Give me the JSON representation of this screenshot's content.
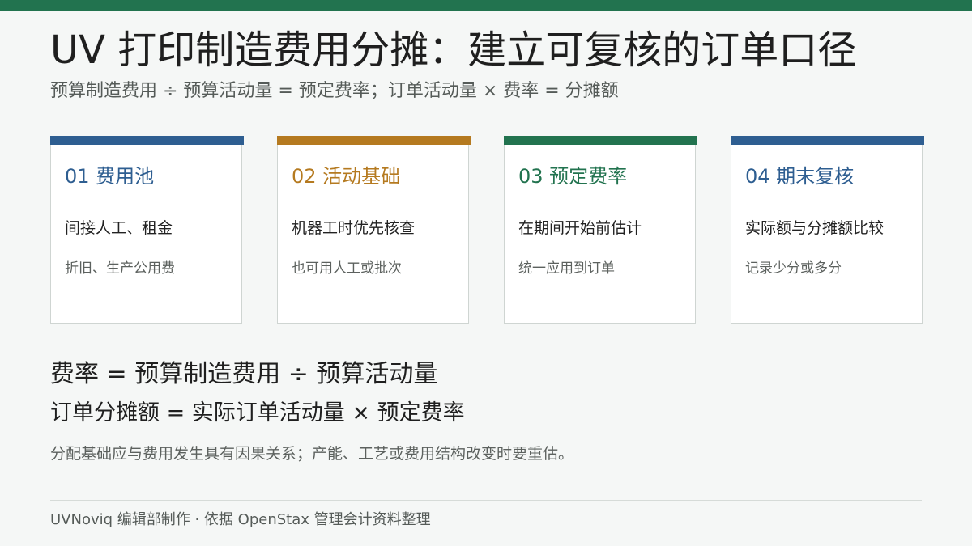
{
  "title": "UV 打印制造费用分摊：建立可复核的订单口径",
  "subtitle": "预算制造费用 ÷ 预算活动量 = 预定费率；订单活动量 × 费率 = 分摊额",
  "cards": [
    {
      "title": "01 费用池",
      "line1": "间接人工、租金",
      "line2": "折旧、生产公用费",
      "color": "#2e5e91"
    },
    {
      "title": "02 活动基础",
      "line1": "机器工时优先核查",
      "line2": "也可用人工或批次",
      "color": "#b57a20"
    },
    {
      "title": "03 预定费率",
      "line1": "在期间开始前估计",
      "line2": "统一应用到订单",
      "color": "#22734f"
    },
    {
      "title": "04 期末复核",
      "line1": "实际额与分摊额比较",
      "line2": "记录少分或多分",
      "color": "#2e5e91"
    }
  ],
  "formula1": "费率 = 预算制造费用 ÷ 预算活动量",
  "formula2": "订单分摊额 = 实际订单活动量 × 预定费率",
  "note": "分配基础应与费用发生具有因果关系；产能、工艺或费用结构改变时要重估。",
  "footer": "UVNoviq 编辑部制作 · 依据 OpenStax 管理会计资料整理",
  "colors": {
    "top_bar": "#22734f",
    "background": "#f5f7f6"
  }
}
